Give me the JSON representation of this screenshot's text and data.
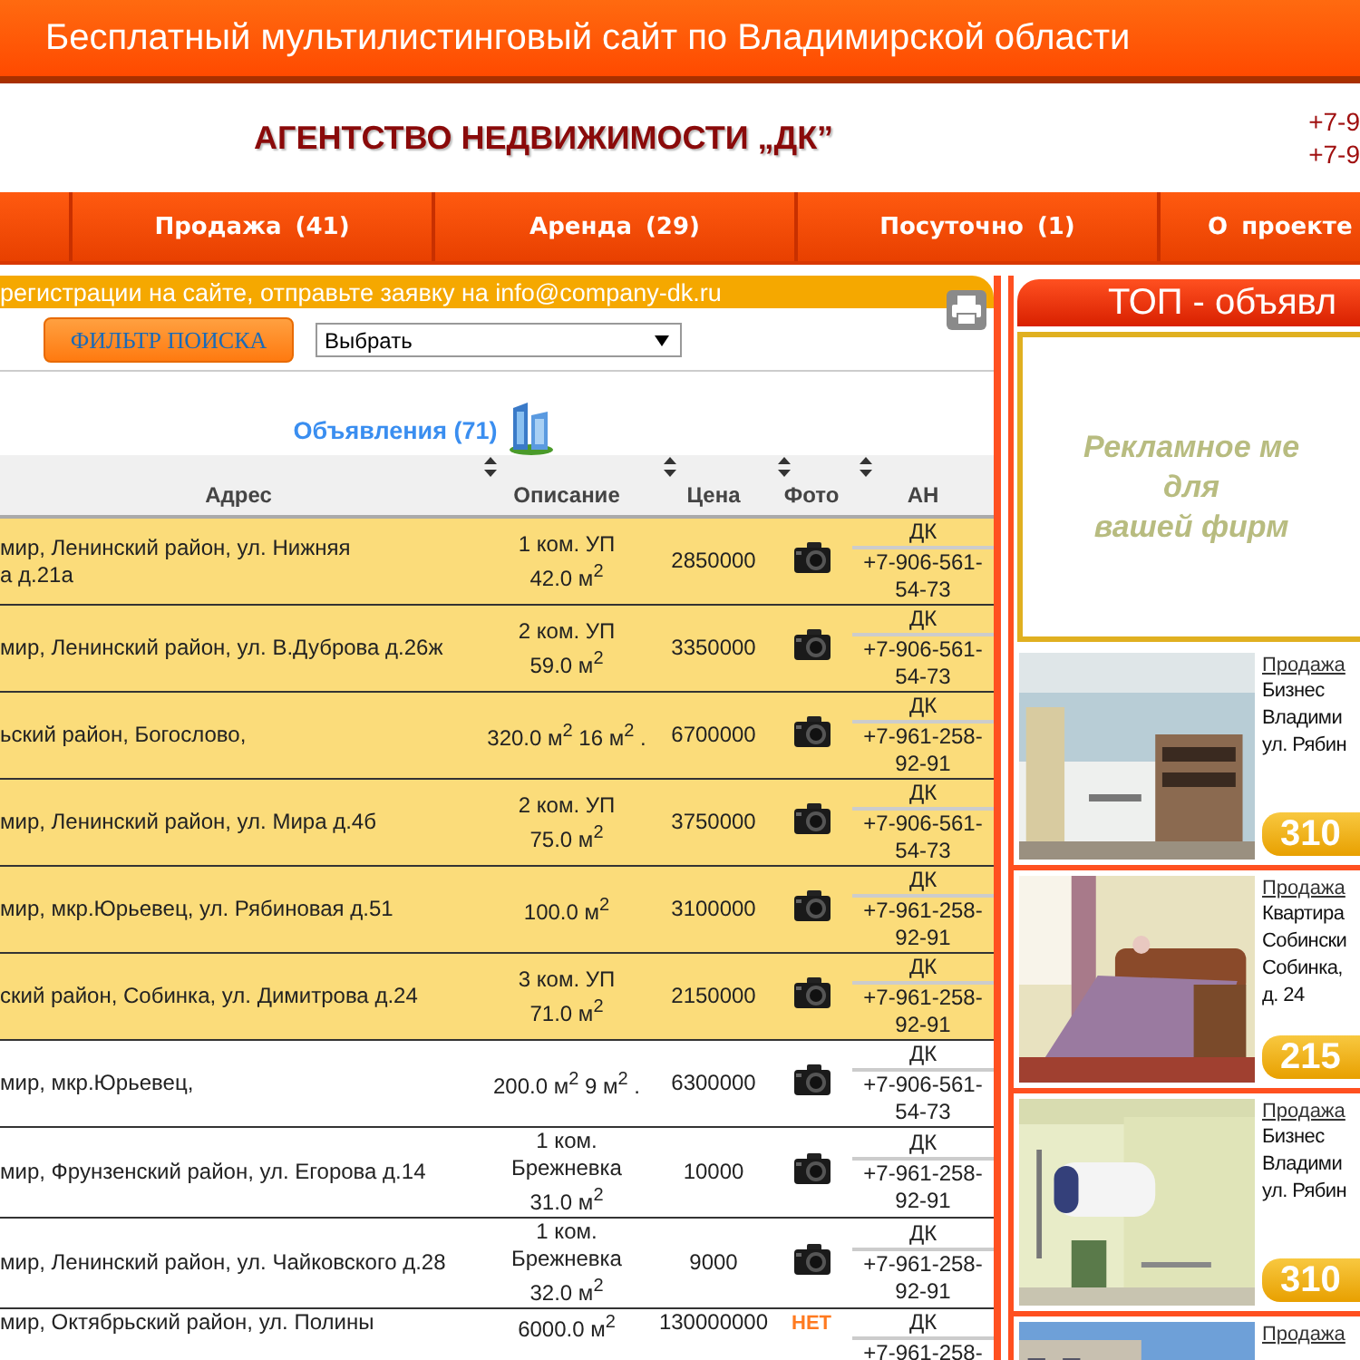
{
  "banner": {
    "title": "Бесплатный мультилистинговый сайт по Владимирской области"
  },
  "header": {
    "agency": "АГЕНТСТВО НЕДВИЖИМОСТИ „ДК”",
    "phones": [
      "+7-9",
      "+7-9"
    ]
  },
  "nav": [
    {
      "label": "Продажа (41)"
    },
    {
      "label": "Аренда (29)"
    },
    {
      "label": "Посуточно (1)"
    },
    {
      "label": "О проекте"
    }
  ],
  "notice": "регистрации на сайте, отправьте заявку на info@company-dk.ru",
  "filter": {
    "button": "ФИЛЬТР ПОИСКА",
    "select_value": "Выбрать"
  },
  "listings_title": "Объявления (71)",
  "columns": [
    {
      "label": "Адрес",
      "sortable": false
    },
    {
      "label": "Описание",
      "sortable": true
    },
    {
      "label": "Цена",
      "sortable": true
    },
    {
      "label": "Фото",
      "sortable": true
    },
    {
      "label": "АН",
      "sortable": true
    }
  ],
  "no_photo_label": "НЕТ",
  "rows": [
    {
      "address": "мир, Ленинский район, ул. Нижняя\nа д.21а",
      "description": "1 ком. УП\n42.0 м$^{2}$",
      "price": "2850000",
      "has_photo": true,
      "agency": "ДК",
      "phone": "+7-906-561-54-73",
      "highlighted": true
    },
    {
      "address": "мир, Ленинский район, ул. В.Дуброва д.26ж",
      "description": "2 ком. УП\n59.0 м$^{2}$",
      "price": "3350000",
      "has_photo": true,
      "agency": "ДК",
      "phone": "+7-906-561-54-73",
      "highlighted": true
    },
    {
      "address": "ьский район, Богослово,",
      "description": "320.0 м$^{2}$ 16 м$^{2}$ .",
      "price": "6700000",
      "has_photo": true,
      "agency": "ДК",
      "phone": "+7-961-258-92-91",
      "highlighted": true
    },
    {
      "address": "мир, Ленинский район, ул. Мира д.4б",
      "description": "2 ком. УП\n75.0 м$^{2}$",
      "price": "3750000",
      "has_photo": true,
      "agency": "ДК",
      "phone": "+7-906-561-54-73",
      "highlighted": true
    },
    {
      "address": "мир, мкр.Юрьевец, ул. Рябиновая д.51",
      "description": "100.0 м$^{2}$",
      "price": "3100000",
      "has_photo": true,
      "agency": "ДК",
      "phone": "+7-961-258-92-91",
      "highlighted": true
    },
    {
      "address": "ский район, Собинка, ул. Димитрова д.24",
      "description": "3 ком. УП\n71.0 м$^{2}$",
      "price": "2150000",
      "has_photo": true,
      "agency": "ДК",
      "phone": "+7-961-258-92-91",
      "highlighted": true
    },
    {
      "address": "мир, мкр.Юрьевец,",
      "description": "200.0 м$^{2}$ 9 м$^{2}$ .",
      "price": "6300000",
      "has_photo": true,
      "agency": "ДК",
      "phone": "+7-906-561-54-73",
      "highlighted": false
    },
    {
      "address": "мир, Фрунзенский район, ул. Егорова д.14",
      "description": "1 ком.\nБрежневка\n31.0 м$^{2}$",
      "price": "10000",
      "has_photo": true,
      "agency": "ДК",
      "phone": "+7-961-258-92-91",
      "highlighted": false
    },
    {
      "address": "мир, Ленинский район, ул. Чайковского д.28",
      "description": "1 ком.\nБрежневка\n32.0 м$^{2}$",
      "price": "9000",
      "has_photo": true,
      "agency": "ДК",
      "phone": "+7-961-258-92-91",
      "highlighted": false
    },
    {
      "address": "мир, Октябрьский район, ул. Полины",
      "description": "6000.0 м$^{2}$",
      "price": "130000000",
      "has_photo": false,
      "agency": "ДК",
      "phone": "+7-961-258-",
      "highlighted": false
    }
  ],
  "top": {
    "title": "ТОП - объявл",
    "ad_text": "Рекламное ме\nдля\nвашей фирм",
    "cards": [
      {
        "category": "Продажа",
        "details": "Бизнес\nВладими\nул. Рябин",
        "price": "310"
      },
      {
        "category": "Продажа",
        "details": "Квартира\nСобински\nСобинка,\nд. 24",
        "price": "215"
      },
      {
        "category": "Продажа",
        "details": "Бизнес\nВладими\nул. Рябин",
        "price": "310"
      },
      {
        "category": "Продажа"
      }
    ]
  }
}
